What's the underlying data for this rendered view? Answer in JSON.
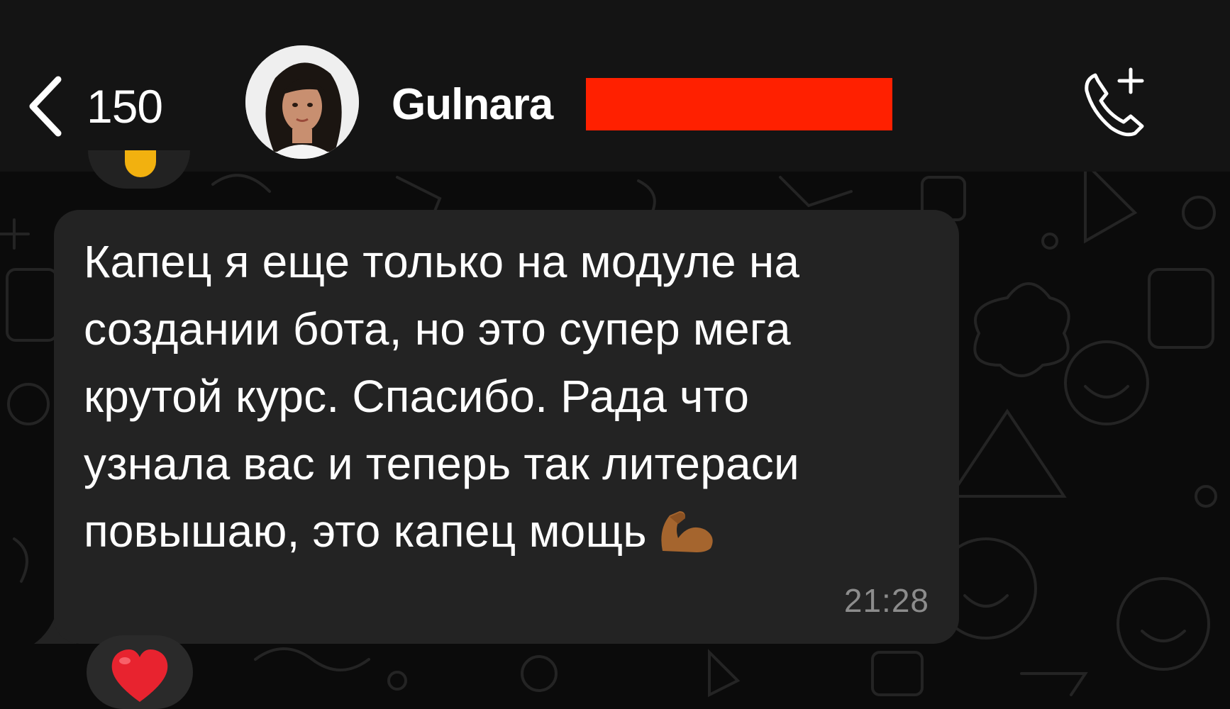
{
  "header": {
    "back_count": "150",
    "contact_name": "Gulnara",
    "icons": {
      "back": "chevron-left-icon",
      "call": "add-call-icon"
    }
  },
  "message": {
    "lines": [
      "Капец я еще только на модуле на",
      "создании бота, но это супер мега",
      "крутой курс. Спасибо. Рада что",
      "узнала вас и теперь так литераси",
      "повышаю, это капец мощь"
    ],
    "emoji": "flexed-biceps-icon",
    "time": "21:28"
  },
  "reaction": {
    "emoji": "red-heart-icon"
  },
  "colors": {
    "background": "#0b0b0b",
    "header": "#141414",
    "bubble": "#232323",
    "text": "#ffffff",
    "timestamp": "#8c8c8c",
    "redaction": "#ff2000",
    "heart": "#e8232f"
  }
}
